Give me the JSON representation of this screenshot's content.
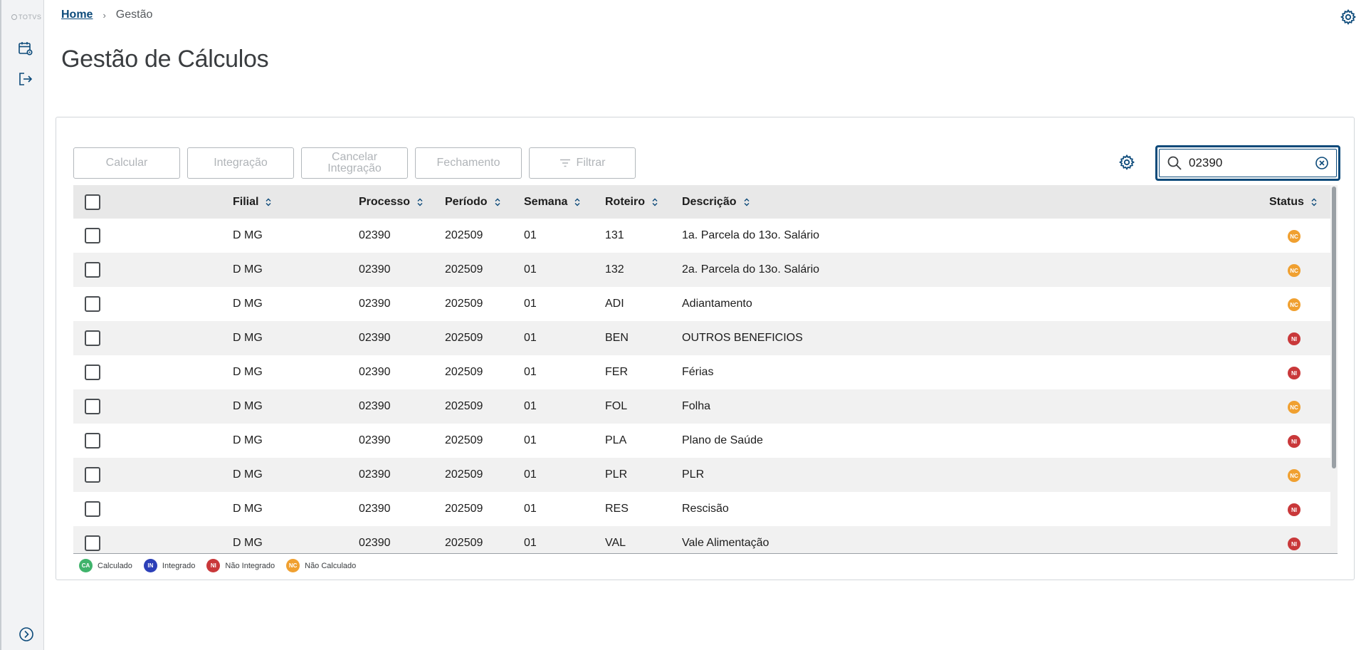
{
  "sidebar": {
    "logo_text": "TOTVS",
    "items": [
      {
        "icon": "calendar-settings-icon"
      },
      {
        "icon": "logout-icon"
      }
    ],
    "expand_icon": "chevron-right-circle-icon"
  },
  "breadcrumb": {
    "home": "Home",
    "separator": "›",
    "current": "Gestão"
  },
  "page": {
    "title": "Gestão de Cálculos"
  },
  "toolbar": {
    "calcular": "Calcular",
    "integracao": "Integração",
    "cancelar_line1": "Cancelar",
    "cancelar_line2": "Integração",
    "fechamento": "Fechamento",
    "filtrar": "Filtrar"
  },
  "search": {
    "value": "02390",
    "placeholder": ""
  },
  "table": {
    "columns": {
      "filial": "Filial",
      "processo": "Processo",
      "periodo": "Período",
      "semana": "Semana",
      "roteiro": "Roteiro",
      "descricao": "Descrição",
      "status": "Status"
    },
    "rows": [
      {
        "filial": "D MG",
        "processo": "02390",
        "periodo": "202509",
        "semana": "01",
        "roteiro": "131",
        "descricao": "1a. Parcela do 13o. Salário",
        "status": "NC"
      },
      {
        "filial": "D MG",
        "processo": "02390",
        "periodo": "202509",
        "semana": "01",
        "roteiro": "132",
        "descricao": "2a. Parcela do 13o. Salário",
        "status": "NC"
      },
      {
        "filial": "D MG",
        "processo": "02390",
        "periodo": "202509",
        "semana": "01",
        "roteiro": "ADI",
        "descricao": "Adiantamento",
        "status": "NC"
      },
      {
        "filial": "D MG",
        "processo": "02390",
        "periodo": "202509",
        "semana": "01",
        "roteiro": "BEN",
        "descricao": "OUTROS BENEFICIOS",
        "status": "NI"
      },
      {
        "filial": "D MG",
        "processo": "02390",
        "periodo": "202509",
        "semana": "01",
        "roteiro": "FER",
        "descricao": "Férias",
        "status": "NI"
      },
      {
        "filial": "D MG",
        "processo": "02390",
        "periodo": "202509",
        "semana": "01",
        "roteiro": "FOL",
        "descricao": "Folha",
        "status": "NC"
      },
      {
        "filial": "D MG",
        "processo": "02390",
        "periodo": "202509",
        "semana": "01",
        "roteiro": "PLA",
        "descricao": "Plano de Saúde",
        "status": "NI"
      },
      {
        "filial": "D MG",
        "processo": "02390",
        "periodo": "202509",
        "semana": "01",
        "roteiro": "PLR",
        "descricao": "PLR",
        "status": "NC"
      },
      {
        "filial": "D MG",
        "processo": "02390",
        "periodo": "202509",
        "semana": "01",
        "roteiro": "RES",
        "descricao": "Rescisão",
        "status": "NI"
      },
      {
        "filial": "D MG",
        "processo": "02390",
        "periodo": "202509",
        "semana": "01",
        "roteiro": "VAL",
        "descricao": "Vale Alimentação",
        "status": "NI"
      }
    ]
  },
  "legend": [
    {
      "code": "CA",
      "label": "Calculado",
      "color": "#3fb36b"
    },
    {
      "code": "IN",
      "label": "Integrado",
      "color": "#2b3fb8"
    },
    {
      "code": "NI",
      "label": "Não Integrado",
      "color": "#c9383a"
    },
    {
      "code": "NC",
      "label": "Não Calculado",
      "color": "#f0a030"
    }
  ],
  "status_colors": {
    "CA": "#3fb36b",
    "IN": "#2b3fb8",
    "NI": "#c9383a",
    "NC": "#f0a030"
  },
  "accent_color": "#0c4a7a"
}
